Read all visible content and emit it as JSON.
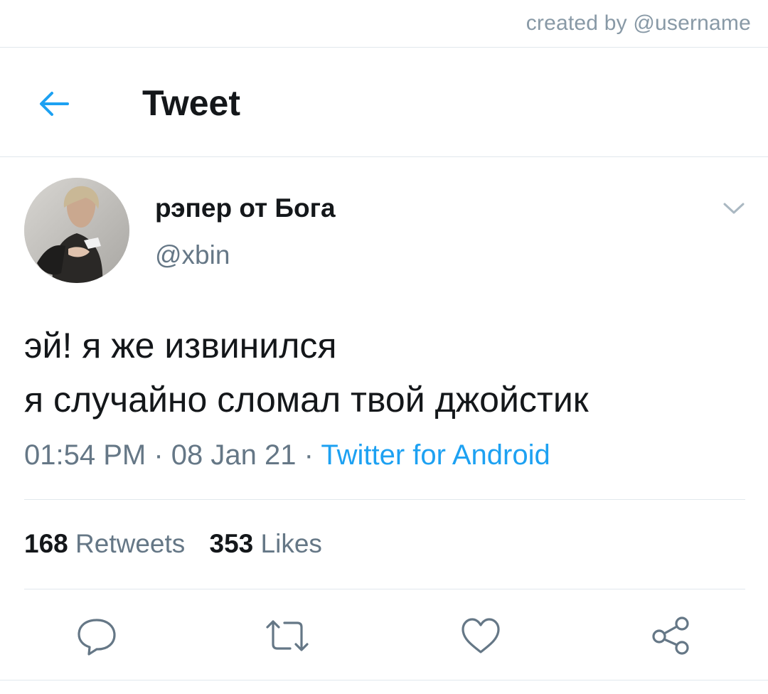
{
  "watermark": "created by @username",
  "header": {
    "title": "Tweet",
    "back_icon": "arrow-left-icon"
  },
  "tweet": {
    "display_name": "рэпер от Бога",
    "handle": "@xbin",
    "text_lines": [
      "эй! я же извинился",
      "я случайно сломал твой джойстик"
    ],
    "time": "01:54 PM",
    "date": "08 Jan 21",
    "separator": "·",
    "source": "Twitter for Android",
    "retweets_count": "168",
    "retweets_label": "Retweets",
    "likes_count": "353",
    "likes_label": "Likes"
  },
  "actions": [
    "reply-icon",
    "retweet-icon",
    "like-icon",
    "share-icon"
  ],
  "colors": {
    "accent": "#1da1f2",
    "text": "#14171a",
    "secondary": "#657786",
    "divider": "#e1e8ed",
    "icon": "#657786"
  }
}
